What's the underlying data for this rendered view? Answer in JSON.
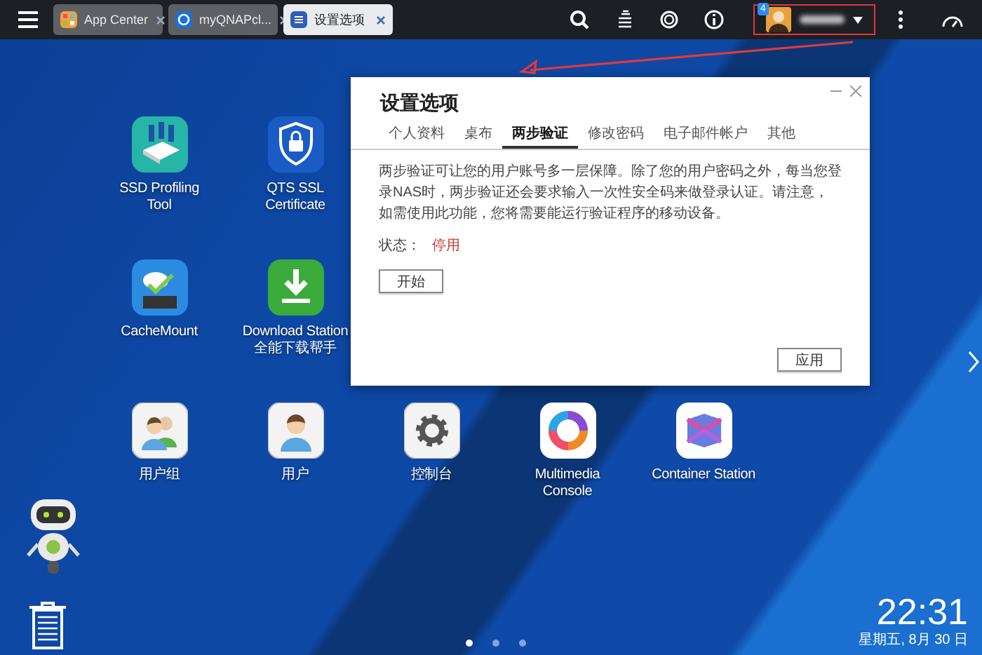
{
  "top_bar": {
    "tabs": [
      {
        "label": "App Center",
        "kind": "appcenter",
        "selected": false
      },
      {
        "label": "myQNAPcl...",
        "kind": "cloud",
        "selected": false
      },
      {
        "label": "设置选项",
        "kind": "settings",
        "selected": true
      }
    ],
    "notification_count": "4"
  },
  "desktop": {
    "rows": [
      [
        {
          "label": "SSD Profiling Tool",
          "kind": "ssd"
        },
        {
          "label": "QTS SSL Certificate",
          "kind": "ssl"
        }
      ],
      [
        {
          "label": "CacheMount",
          "kind": "cache"
        },
        {
          "label": "Download Station 全能下载帮手",
          "kind": "download"
        }
      ],
      [
        {
          "label": "用户组",
          "kind": "group"
        },
        {
          "label": "用户",
          "kind": "user"
        },
        {
          "label": "控制台",
          "kind": "gear"
        },
        {
          "label": "Multimedia Console",
          "kind": "media"
        },
        {
          "label": "Container Station",
          "kind": "container"
        }
      ]
    ],
    "pagination": [
      {
        "selected": true
      },
      {
        "selected": false
      },
      {
        "selected": false
      }
    ],
    "clock": {
      "time": "22:31",
      "date": "星期五, 8月 30 日"
    }
  },
  "dialog": {
    "title": "设置选项",
    "tabs": [
      {
        "label": "个人资料",
        "selected": false
      },
      {
        "label": "桌布",
        "selected": false
      },
      {
        "label": "两步验证",
        "selected": true
      },
      {
        "label": "修改密码",
        "selected": false
      },
      {
        "label": "电子邮件帐户",
        "selected": false
      },
      {
        "label": "其他",
        "selected": false
      }
    ],
    "description": "两步验证可让您的用户账号多一层保障。除了您的用户密码之外，每当您登录NAS时，两步验证还会要求输入一次性安全码来做登录认证。请注意，如需使用此功能，您将需要能运行验证程序的移动设备。",
    "status_label": "状态：",
    "status_value": "停用",
    "start_button": "开始",
    "apply_button": "应用"
  }
}
